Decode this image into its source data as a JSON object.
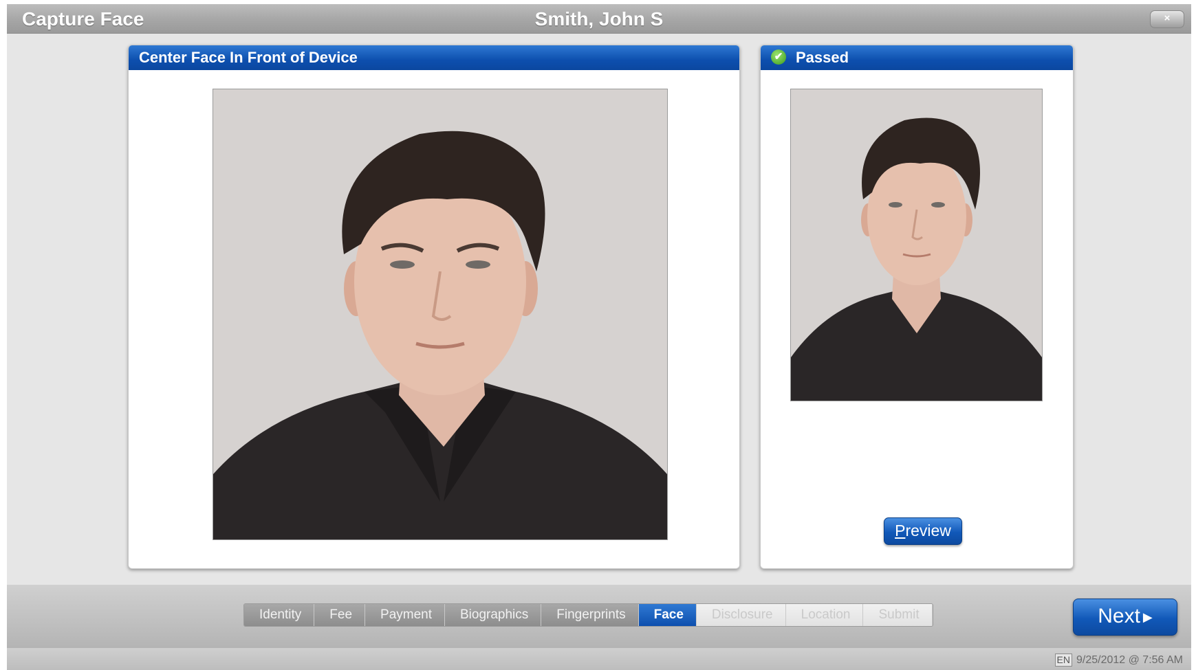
{
  "window": {
    "title": "Capture Face",
    "subject_name": "Smith, John S",
    "close_label": "×"
  },
  "capture_panel": {
    "heading": "Center Face In Front of Device"
  },
  "result_panel": {
    "status": "Passed",
    "preview_label": "Preview"
  },
  "steps": [
    {
      "label": "Identity",
      "state": "done"
    },
    {
      "label": "Fee",
      "state": "done"
    },
    {
      "label": "Payment",
      "state": "done"
    },
    {
      "label": "Biographics",
      "state": "done"
    },
    {
      "label": "Fingerprints",
      "state": "done"
    },
    {
      "label": "Face",
      "state": "active"
    },
    {
      "label": "Disclosure",
      "state": "pending"
    },
    {
      "label": "Location",
      "state": "pending"
    },
    {
      "label": "Submit",
      "state": "pending"
    }
  ],
  "next_label": "Next",
  "status_bar": {
    "language": "EN",
    "datetime": "9/25/2012 @ 7:56 AM"
  },
  "colors": {
    "accent_blue": "#0d4fae",
    "passed_green": "#3a9b1c"
  }
}
